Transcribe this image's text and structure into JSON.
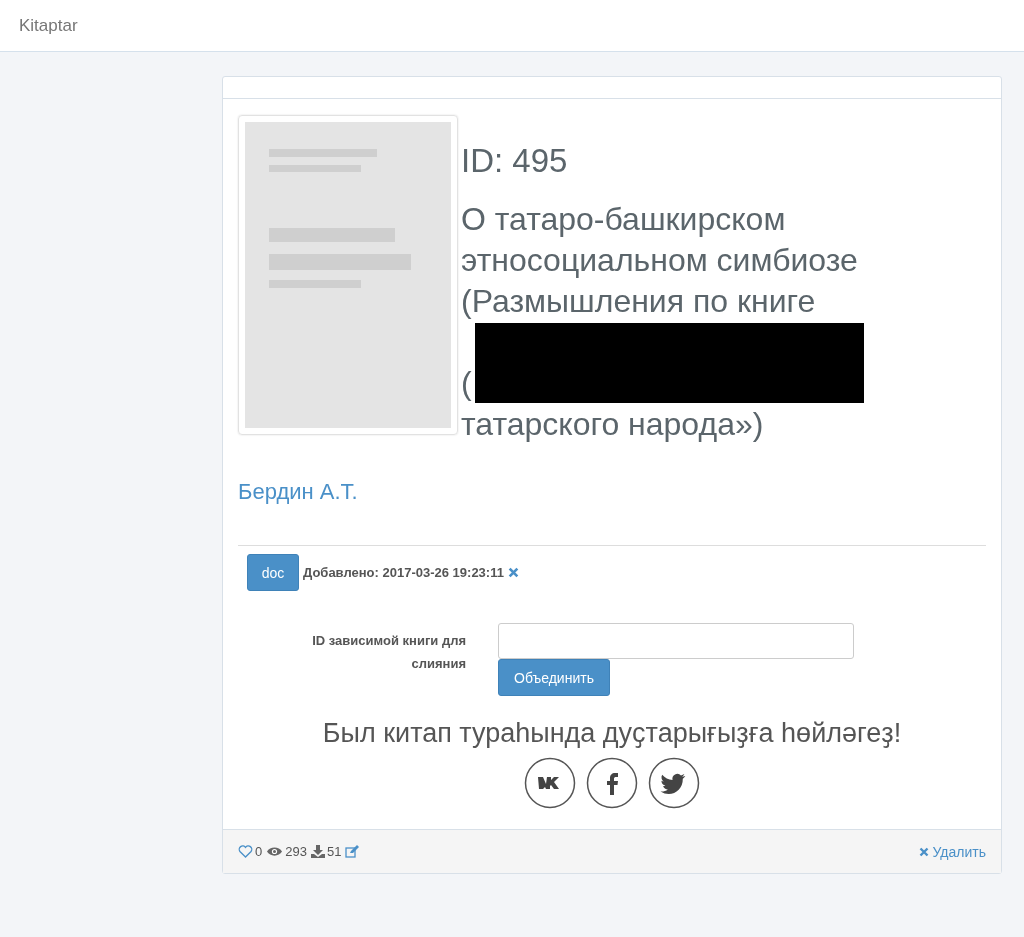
{
  "navbar": {
    "brand": "Kitaptar"
  },
  "book": {
    "id_label": "ID: 495",
    "title_lines": [
      "О татаро-башкирском",
      "этносоциальном симбиозе",
      "(Размышления по книге",
      "(",
      "татарского народа»)"
    ],
    "author": "Бердин А.Т."
  },
  "file": {
    "format": "doc",
    "added": "Добавлено: 2017-03-26 19:23:11"
  },
  "merge": {
    "label": "ID зависимой книги для слияния",
    "button": "Объединить"
  },
  "share": {
    "heading": "Был китап тураһында дуҫтарығыҙға һөйләгеҙ!"
  },
  "footer": {
    "likes": "0",
    "views": "293",
    "downloads": "51",
    "delete": "Удалить"
  }
}
